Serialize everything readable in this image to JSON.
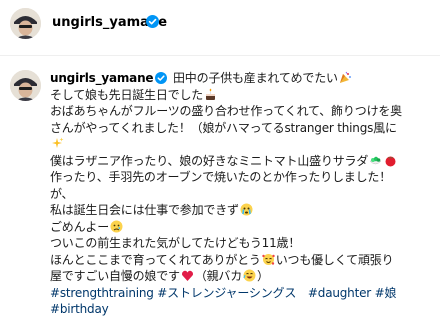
{
  "header": {
    "username": "ungirls_yamane"
  },
  "post": {
    "username": "ungirls_yamane",
    "lines": [
      {
        "text": " 田中の子供も産まれてめでたい",
        "icon": "party-popper-icon"
      },
      {
        "text": "そして娘も先日誕生日でした",
        "icon": "birthday-cake-icon"
      },
      {
        "text": "おばあちゃんがフルーツの盛り合わせ作ってくれて、飾りつけを奥"
      },
      {
        "text": "さんがやってくれました！（娘がハマってるstranger things風に"
      },
      {
        "text": "",
        "icon": "sparkles-icon"
      },
      {
        "text": "僕はラザニア作ったり、娘の好きなミニトマト山盛りサラダ",
        "icon": "salad-icon",
        "icon2": "tomato-icon"
      },
      {
        "text": "作ったり、手羽先のオーブンで焼いたのとか作ったりしました！"
      },
      {
        "text": "が、"
      },
      {
        "text": "私は誕生日会には仕事で参加できず",
        "icon": "crying-face-icon"
      },
      {
        "text": "ごめんよー",
        "icon": "sad-face-icon"
      },
      {
        "text": "ついこの前生まれた気がしてたけどもう11歳！"
      },
      {
        "text": "ほんとここまで育ってくれてありがとう",
        "icon": "smiling-hearts-icon",
        "after": "いつも優しくて頑張り"
      },
      {
        "text": "屋ですごい自慢の娘です",
        "icon": "red-heart-icon",
        "after": "（親バカ",
        "icon2": "grinning-face-icon",
        "after2": "）"
      }
    ],
    "hashtags_line1": "#strengthtraining #ストレンジャーシングス　#daughter #娘",
    "hashtags_line2": "#birthday"
  },
  "colors": {
    "hashtag": "#00376b",
    "verified": "#0095f6"
  }
}
